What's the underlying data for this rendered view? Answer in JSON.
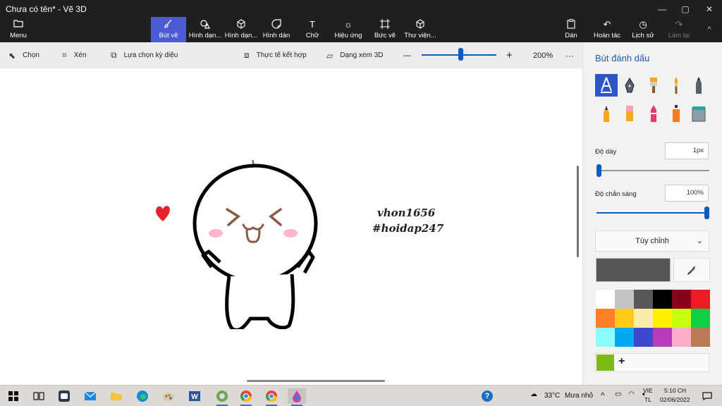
{
  "window": {
    "title": "Chưa có tên* - Vẽ 3D",
    "min": "—",
    "max": "▢",
    "close": "✕"
  },
  "ribbon": {
    "menu": "Menu",
    "tabs": [
      "Bút vẽ",
      "Hình dạn...",
      "Hình dạn...",
      "Hình dán",
      "Chữ",
      "Hiệu ứng",
      "Bức vẽ",
      "Thư viện..."
    ],
    "paste": "Dán",
    "undo": "Hoàn tác",
    "history": "Lịch sử",
    "redo": "Làm lại",
    "collapse": "^"
  },
  "toolbar": {
    "select": "Chọn",
    "crop": "Xén",
    "magic_select": "Lựa chọn kỳ diệu",
    "mixed_reality": "Thực tế kết hợp",
    "view_3d": "Dạng xem 3D",
    "zoom_out": "—",
    "zoom_in": "+",
    "zoom": "200%",
    "more": "···"
  },
  "canvas": {
    "text_line1": "vhon1656",
    "text_line2": "#hoidap247"
  },
  "panel": {
    "title": "Bút đánh dấu",
    "brushes": [
      "marker",
      "calligraphy-pen",
      "oil-brush",
      "watercolor",
      "pencil",
      "pixel-pen",
      "eraser",
      "crayon",
      "spray-can",
      "fill"
    ],
    "thickness_label": "Độ dày",
    "thickness_value": "1px",
    "thickness_level": 0.0,
    "opacity_label": "Độ chắn sáng",
    "opacity_value": "100%",
    "opacity_level": 1.0,
    "dropdown": "Tùy chỉnh",
    "current_color": "#555555",
    "palette": [
      "#ffffff",
      "#c3c3c3",
      "#585858",
      "#000000",
      "#88001b",
      "#ec1c24",
      "#ff7f27",
      "#ffca18",
      "#fdeca6",
      "#fff200",
      "#c4ff0e",
      "#0ed145",
      "#8cfffb",
      "#00a8f3",
      "#3f48cc",
      "#b83dba",
      "#ffaec8",
      "#b97a56"
    ],
    "custom_color": "#7cba14",
    "add": "+"
  },
  "taskbar": {
    "apps": [
      "start-icon",
      "task-view-icon",
      "zalo-icon",
      "mail-icon",
      "file-explorer-icon",
      "edge-icon",
      "paint-icon",
      "word-icon",
      "store-icon",
      "chrome-icon",
      "chrome-icon",
      "paint-3d-icon"
    ],
    "help": "?",
    "weather": "33°C",
    "weather_desc": "Mưa nhỏ",
    "lang1": "VIE",
    "lang2": "TL",
    "time": "5:10 CH",
    "date": "02/06/2022"
  }
}
